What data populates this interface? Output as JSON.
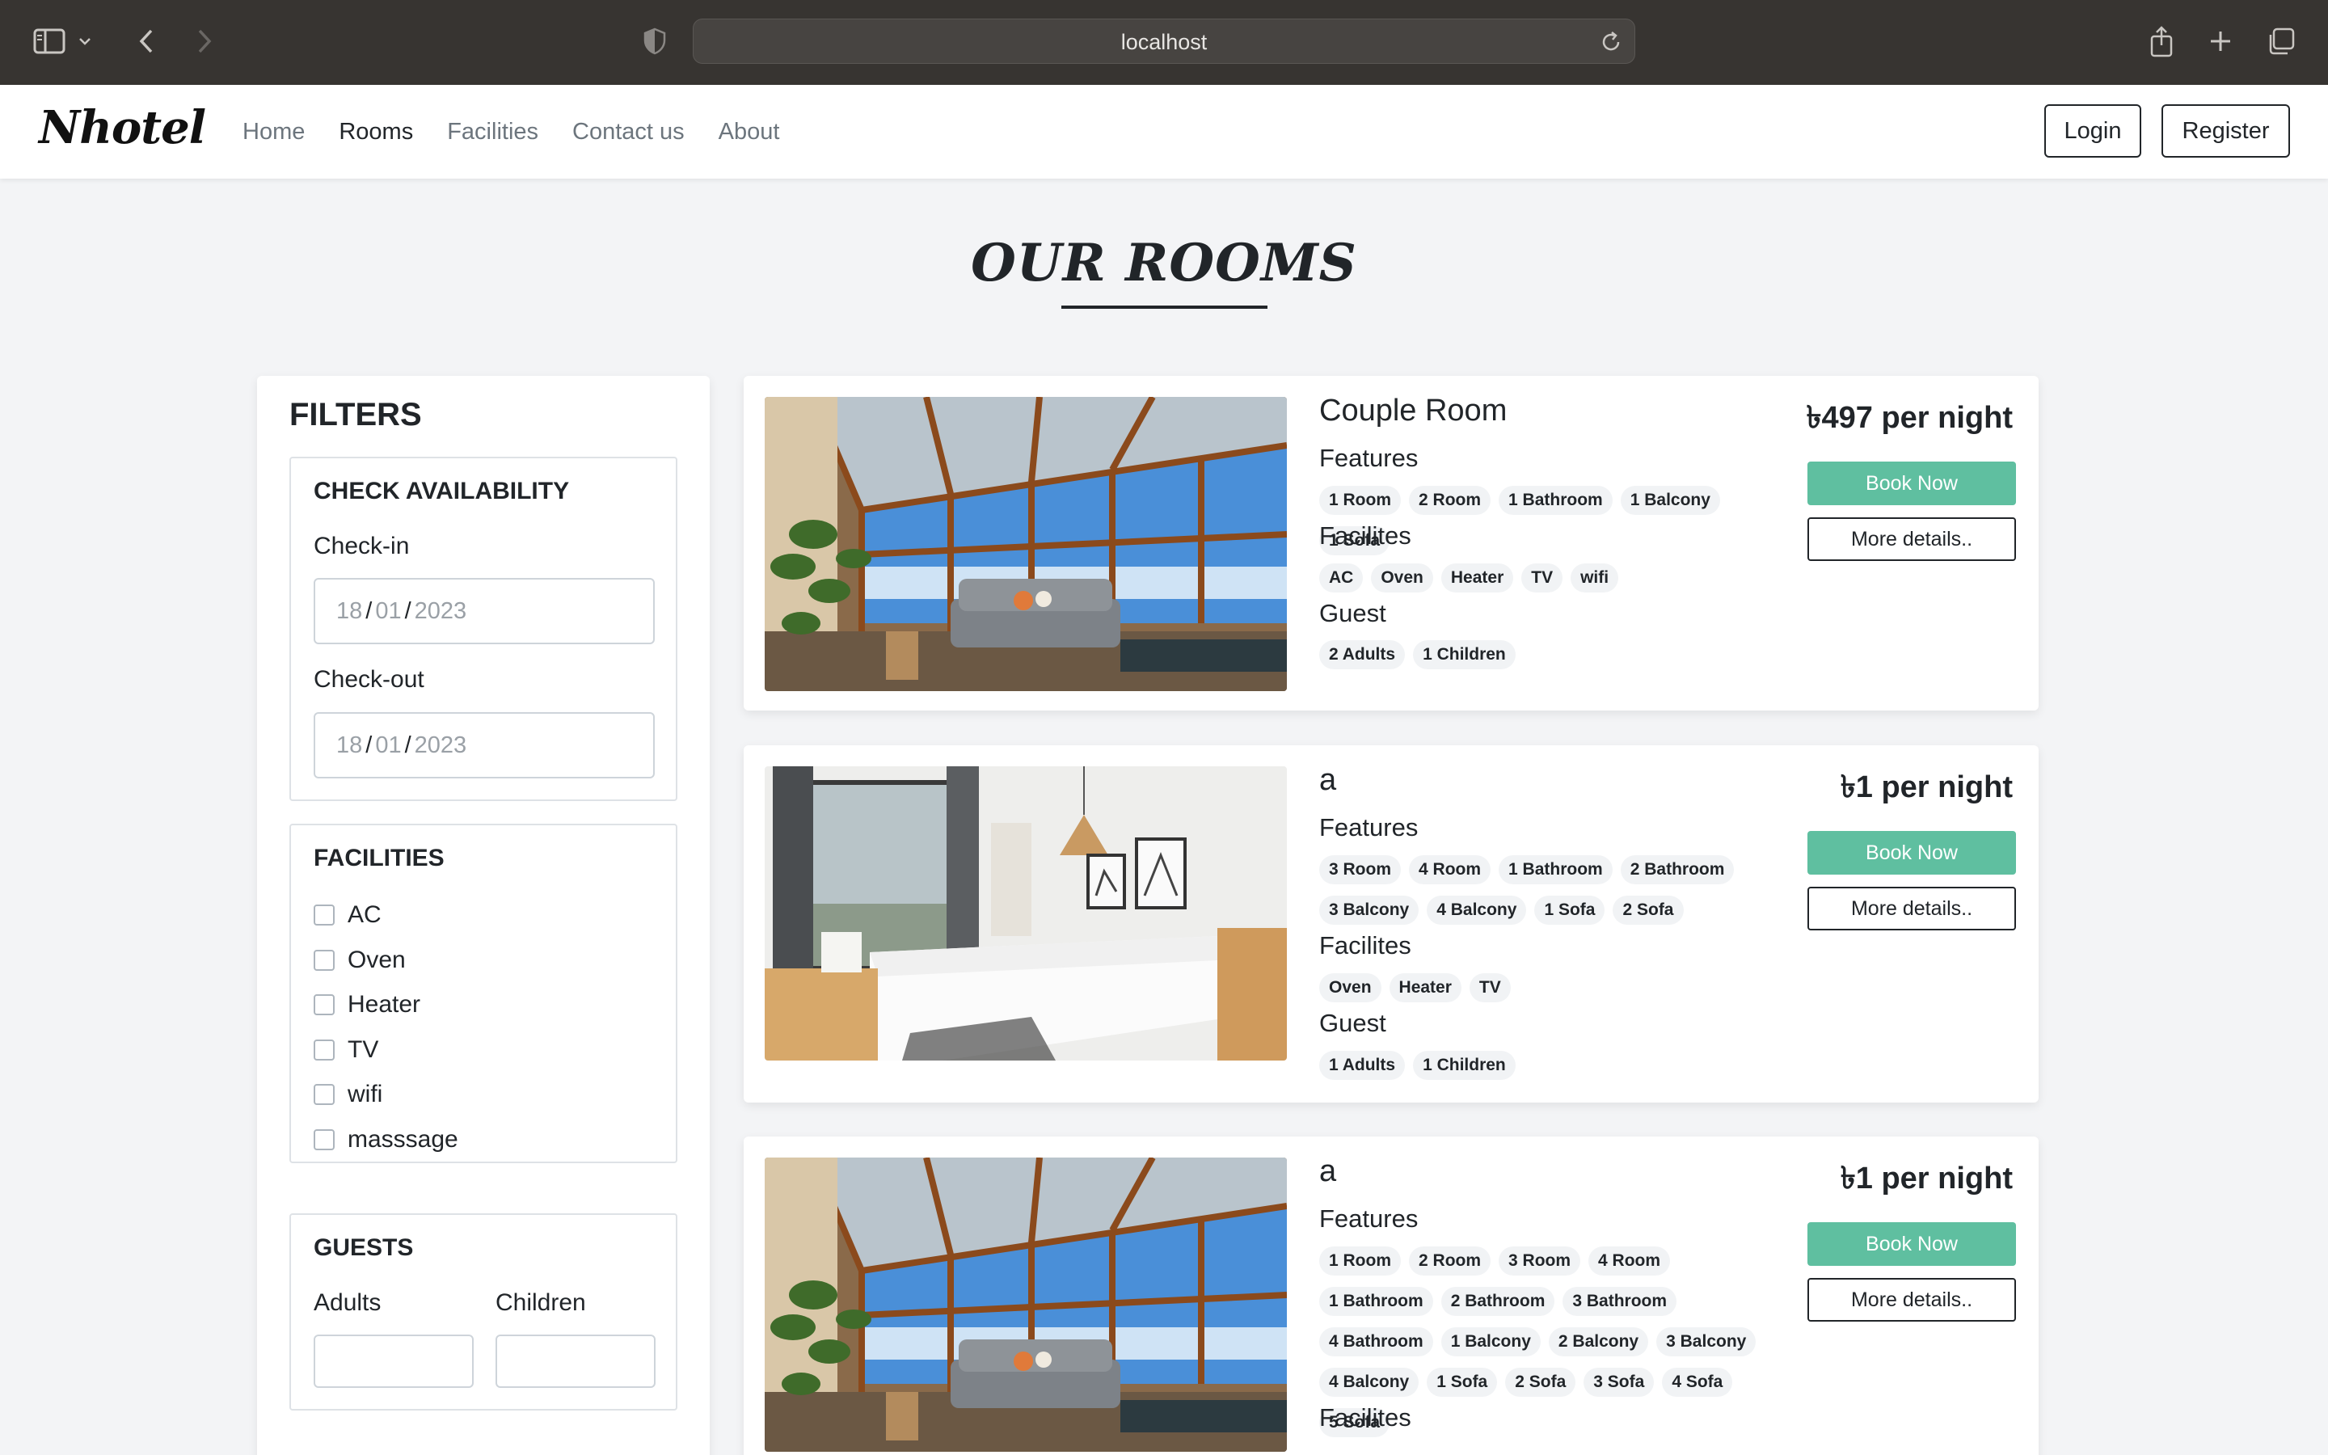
{
  "browser": {
    "url": "localhost",
    "icons": [
      "sidebar-toggle-icon",
      "chevron-down-icon",
      "back-arrow-icon",
      "forward-arrow-icon",
      "shield-icon",
      "reload-icon",
      "share-icon",
      "plus-icon",
      "tabs-overview-icon"
    ]
  },
  "navbar": {
    "brand": "Nhotel",
    "links": [
      "Home",
      "Rooms",
      "Facilities",
      "Contact us",
      "About"
    ],
    "active_link": "Rooms",
    "login_label": "Login",
    "register_label": "Register"
  },
  "page": {
    "heading": "OUR ROOMS"
  },
  "filters": {
    "title": "FILTERS",
    "availability": {
      "title": "CHECK AVAILABILITY",
      "checkin_label": "Check-in",
      "checkin_value": {
        "day": "18",
        "month": "01",
        "year": "2023"
      },
      "checkout_label": "Check-out",
      "checkout_value": {
        "day": "18",
        "month": "01",
        "year": "2023"
      }
    },
    "facilities": {
      "title": "FACILITIES",
      "options": [
        "AC",
        "Oven",
        "Heater",
        "TV",
        "wifi",
        "masssage"
      ]
    },
    "guests": {
      "title": "GUESTS",
      "adults_label": "Adults",
      "children_label": "Children"
    }
  },
  "rooms": [
    {
      "name": "Couple Room",
      "price": "৳497 per night",
      "features_label": "Features",
      "features": [
        "1 Room",
        "2 Room",
        "1 Bathroom",
        "1 Balcony",
        "1 Sofa"
      ],
      "facilities_label": "Facilites",
      "facilities": [
        "AC",
        "Oven",
        "Heater",
        "TV",
        "wifi"
      ],
      "guest_label": "Guest",
      "guests": [
        "2 Adults",
        "1 Children"
      ],
      "book_label": "Book Now",
      "details_label": "More details..",
      "image": "sunroom-photo"
    },
    {
      "name": "a",
      "price": "৳1 per night",
      "features_label": "Features",
      "features": [
        "3 Room",
        "4 Room",
        "1 Bathroom",
        "2 Bathroom",
        "3 Balcony",
        "4 Balcony",
        "1 Sofa",
        "2 Sofa"
      ],
      "facilities_label": "Facilites",
      "facilities": [
        "Oven",
        "Heater",
        "TV"
      ],
      "guest_label": "Guest",
      "guests": [
        "1 Adults",
        "1 Children"
      ],
      "book_label": "Book Now",
      "details_label": "More details..",
      "image": "bedroom-photo"
    },
    {
      "name": "a",
      "price": "৳1 per night",
      "features_label": "Features",
      "features": [
        "1 Room",
        "2 Room",
        "3 Room",
        "4 Room",
        "1 Bathroom",
        "2 Bathroom",
        "3 Bathroom",
        "4 Bathroom",
        "1 Balcony",
        "2 Balcony",
        "3 Balcony",
        "4 Balcony",
        "1 Sofa",
        "2 Sofa",
        "3 Sofa",
        "4 Sofa",
        "5 Sofa"
      ],
      "facilities_label": "Facilites",
      "book_label": "Book Now",
      "details_label": "More details..",
      "image": "sunroom-photo"
    }
  ],
  "colors": {
    "accent": "#5fbfa0",
    "chrome": "#373431",
    "page_bg": "#f3f4f6"
  }
}
